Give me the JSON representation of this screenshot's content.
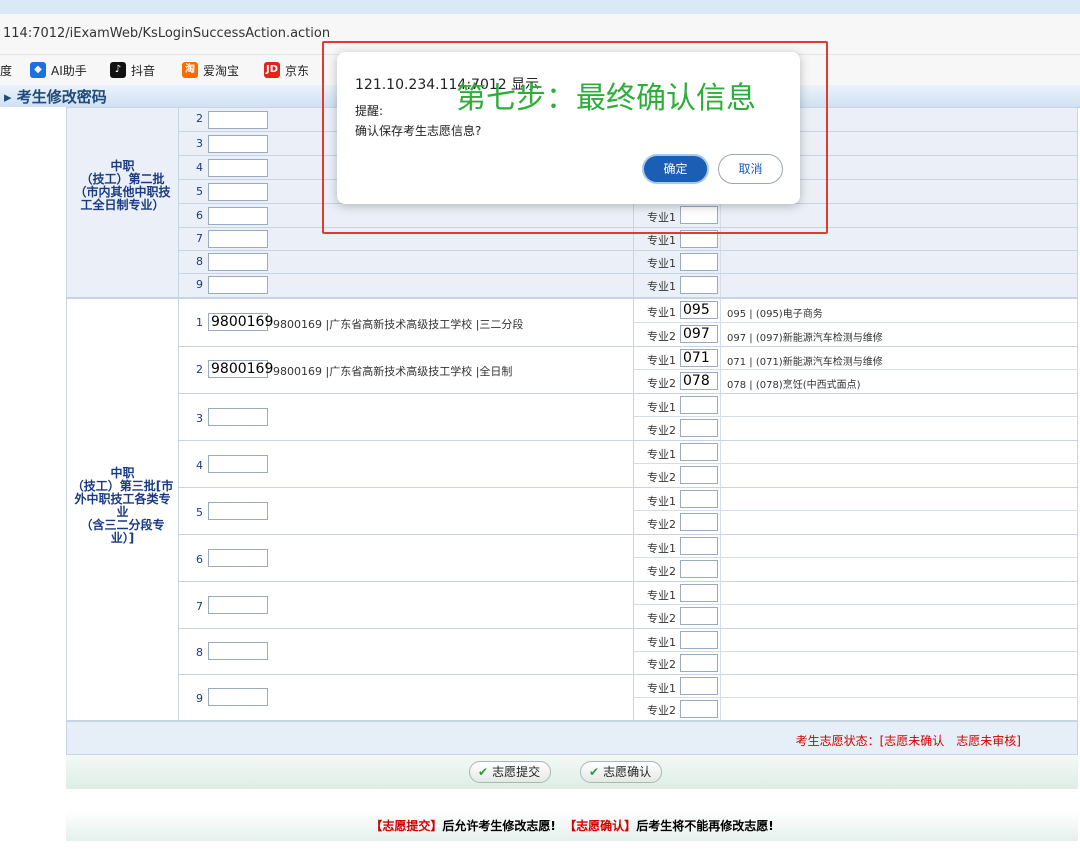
{
  "browser": {
    "url": "114:7012/iExamWeb/KsLoginSuccessAction.action",
    "bookmarks": [
      {
        "icon": "star-icon",
        "label": "度"
      },
      {
        "icon": "ai-assistant-icon",
        "label": "AI助手",
        "color": "#1e6fe0"
      },
      {
        "icon": "douyin-icon",
        "label": "抖音",
        "color": "#111111"
      },
      {
        "icon": "aitaobao-icon",
        "label": "爱淘宝",
        "color": "#ff6a00"
      },
      {
        "icon": "jd-icon",
        "label": "京东",
        "color": "#e1251b"
      }
    ]
  },
  "page_title": "考生修改密码",
  "section2": {
    "category": "中职（技工）第二批（市内其他中职技工全日制专业）",
    "rows": [
      {
        "num": "2",
        "major_label": ""
      },
      {
        "num": "3",
        "major_label": ""
      },
      {
        "num": "4",
        "major_label": ""
      },
      {
        "num": "5",
        "major_label": ""
      },
      {
        "num": "6",
        "major_label": "专业1"
      },
      {
        "num": "7",
        "major_label": "专业1"
      },
      {
        "num": "8",
        "major_label": "专业1"
      },
      {
        "num": "9",
        "major_label": "专业1"
      }
    ]
  },
  "section3": {
    "category": "中职（技工）第三批[市外中职技工各类专业（含三二分段专业）]",
    "rows": [
      {
        "num": "1",
        "school_code": "9800169",
        "school_name": "9800169 |广东省高新技术高级技工学校 |三二分段",
        "majors": [
          {
            "label": "专业1",
            "code": "095",
            "desc": "095 | (095)电子商务"
          },
          {
            "label": "专业2",
            "code": "097",
            "desc": "097 | (097)新能源汽车检测与维修"
          }
        ]
      },
      {
        "num": "2",
        "school_code": "9800169",
        "school_name": "9800169 |广东省高新技术高级技工学校 |全日制",
        "majors": [
          {
            "label": "专业1",
            "code": "071",
            "desc": "071 | (071)新能源汽车检测与维修"
          },
          {
            "label": "专业2",
            "code": "078",
            "desc": "078 | (078)烹饪(中西式面点)"
          }
        ]
      },
      {
        "num": "3",
        "school_code": "",
        "school_name": "",
        "majors": [
          {
            "label": "专业1",
            "code": "",
            "desc": ""
          },
          {
            "label": "专业2",
            "code": "",
            "desc": ""
          }
        ]
      },
      {
        "num": "4",
        "school_code": "",
        "school_name": "",
        "majors": [
          {
            "label": "专业1",
            "code": "",
            "desc": ""
          },
          {
            "label": "专业2",
            "code": "",
            "desc": ""
          }
        ]
      },
      {
        "num": "5",
        "school_code": "",
        "school_name": "",
        "majors": [
          {
            "label": "专业1",
            "code": "",
            "desc": ""
          },
          {
            "label": "专业2",
            "code": "",
            "desc": ""
          }
        ]
      },
      {
        "num": "6",
        "school_code": "",
        "school_name": "",
        "majors": [
          {
            "label": "专业1",
            "code": "",
            "desc": ""
          },
          {
            "label": "专业2",
            "code": "",
            "desc": ""
          }
        ]
      },
      {
        "num": "7",
        "school_code": "",
        "school_name": "",
        "majors": [
          {
            "label": "专业1",
            "code": "",
            "desc": ""
          },
          {
            "label": "专业2",
            "code": "",
            "desc": ""
          }
        ]
      },
      {
        "num": "8",
        "school_code": "",
        "school_name": "",
        "majors": [
          {
            "label": "专业1",
            "code": "",
            "desc": ""
          },
          {
            "label": "专业2",
            "code": "",
            "desc": ""
          }
        ]
      },
      {
        "num": "9",
        "school_code": "",
        "school_name": "",
        "majors": [
          {
            "label": "专业1",
            "code": "",
            "desc": ""
          },
          {
            "label": "专业2",
            "code": "",
            "desc": ""
          }
        ]
      }
    ]
  },
  "status": {
    "text": "考生志愿状态：[志愿未确认　志愿未审核]"
  },
  "buttons": {
    "submit": "志愿提交",
    "confirm": "志愿确认"
  },
  "footer_note": {
    "part1": "【志愿提交】",
    "part2": "后允许考生修改志愿!",
    "part3": "【志愿确认】",
    "part4": "后考生将不能再修改志愿!"
  },
  "dialog": {
    "origin": "121.10.234.114:7012 显示",
    "label": "提醒:",
    "message": "确认保存考生志愿信息?",
    "ok": "确定",
    "cancel": "取消"
  },
  "annotation": {
    "text": "第七步：最终确认信息",
    "color": "#2dae3b",
    "box_color": "#e03b2f"
  }
}
